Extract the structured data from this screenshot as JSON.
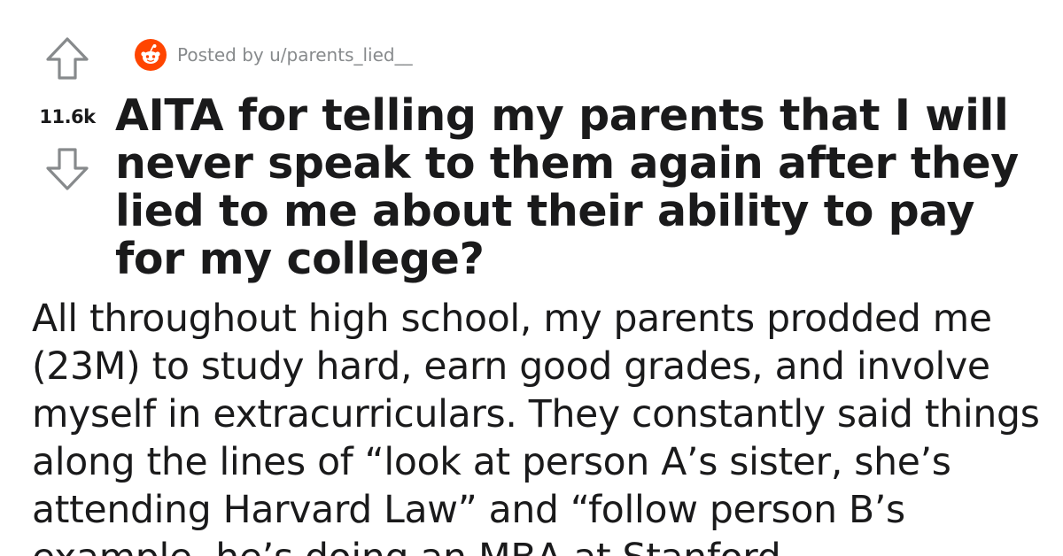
{
  "post": {
    "vote_count": "11.6k",
    "posted_by": "Posted by u/parents_lied__",
    "title": "AITA for telling my parents that I will never speak to them again after they lied to me about their ability to pay for my college?",
    "body": "All throughout high school, my parents prodded me (23M) to study hard, earn good grades, and involve myself in extracurriculars. They constantly said things along the lines of “look at person A’s sister, she’s attending Harvard Law” and “follow person B’s example, he’s doing an MBA at Stanford"
  },
  "icons": {
    "upvote": "arrow-up-outline-icon",
    "downvote": "arrow-down-outline-icon",
    "avatar": "snoo-avatar-icon"
  },
  "colors": {
    "text": "#1a1a1b",
    "meta_text": "#878a8c",
    "vote_arrow": "#878a8c",
    "avatar_bg": "#ff4500"
  }
}
